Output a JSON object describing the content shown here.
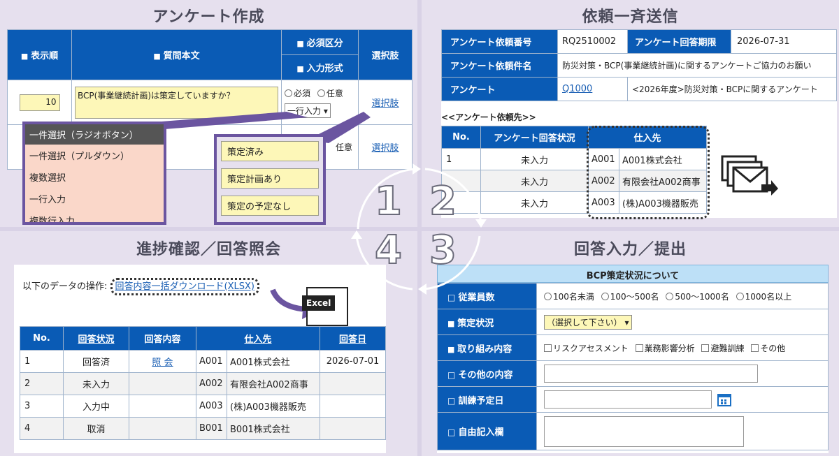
{
  "q1": {
    "title": "アンケート作成",
    "headers": {
      "order": "表示順",
      "question": "質問本文",
      "required": "必須区分",
      "input_type": "入力形式",
      "choices": "選択肢"
    },
    "row1": {
      "order": "10",
      "question": "BCP(事業継続計画)は策定していますか？",
      "req": "必須",
      "opt": "任意",
      "input_type": "一行入力",
      "choices_link": "選択肢"
    },
    "row2": {
      "opt": "任意",
      "choices_link": "選択肢"
    },
    "type_list": [
      "一件選択（ラジオボタン）",
      "一件選択（プルダウン）",
      "複数選択",
      "一行入力",
      "複数行入力"
    ],
    "choice_list": [
      "策定済み",
      "策定計画あり",
      "策定の予定なし"
    ]
  },
  "q2": {
    "title": "依頼一斉送信",
    "info": {
      "req_no_label": "アンケート依頼番号",
      "req_no": "RQ2510002",
      "deadline_label": "アンケート回答期限",
      "deadline": "2026-07-31",
      "subject_label": "アンケート依頼件名",
      "subject": "防災対策・BCP(事業継続計画)に関するアンケートご協力のお願い",
      "survey_label": "アンケート",
      "survey_link": "Q1000",
      "survey_name": "<2026年度>防災対策・BCPに関するアンケート"
    },
    "recipients_caption": "<<アンケート依頼先>>",
    "headers": {
      "no": "No.",
      "status": "アンケート回答状況",
      "supplier": "仕入先"
    },
    "rows": [
      {
        "no": "1",
        "status": "未入力",
        "code": "A001",
        "name": "A001株式会社"
      },
      {
        "no": "",
        "status": "未入力",
        "code": "A002",
        "name": "有限会社A002商事"
      },
      {
        "no": "",
        "status": "未入力",
        "code": "A003",
        "name": "(株)A003機器販売"
      }
    ]
  },
  "q3": {
    "title": "進捗確認／回答照会",
    "ops_label": "以下のデータの操作:",
    "download_link": "回答内容一括ダウンロード(XLSX)",
    "excel_label": "Excel",
    "headers": {
      "no": "No.",
      "status": "回答状況",
      "content": "回答内容",
      "supplier": "仕入先",
      "date": "回答日"
    },
    "rows": [
      {
        "no": "1",
        "status": "回答済",
        "content": "照 会",
        "code": "A001",
        "name": "A001株式会社",
        "date": "2026-07-01"
      },
      {
        "no": "2",
        "status": "未入力",
        "content": "",
        "code": "A002",
        "name": "有限会社A002商事",
        "date": ""
      },
      {
        "no": "3",
        "status": "入力中",
        "content": "",
        "code": "A003",
        "name": "(株)A003機器販売",
        "date": ""
      },
      {
        "no": "4",
        "status": "取消",
        "content": "",
        "code": "B001",
        "name": "B001株式会社",
        "date": ""
      }
    ]
  },
  "q4": {
    "title": "回答入力／提出",
    "form_header": "BCP策定状況について",
    "employees_label": "従業員数",
    "employees_opts": [
      "100名未満",
      "100～500名",
      "500～1000名",
      "1000名以上"
    ],
    "status_label": "策定状況",
    "status_select": "（選択して下さい）",
    "efforts_label": "取り組み内容",
    "efforts_opts": [
      "リスクアセスメント",
      "業務影響分析",
      "避難訓練",
      "その他"
    ],
    "other_label": "その他の内容",
    "training_label": "訓練予定日",
    "free_label": "自由記入欄"
  },
  "cycle": {
    "n1": "1",
    "n2": "2",
    "n3": "3",
    "n4": "4"
  },
  "colors": {
    "accent": "#0a5bb5",
    "purple": "#6b55a0",
    "highlight": "#fdf7b8"
  }
}
